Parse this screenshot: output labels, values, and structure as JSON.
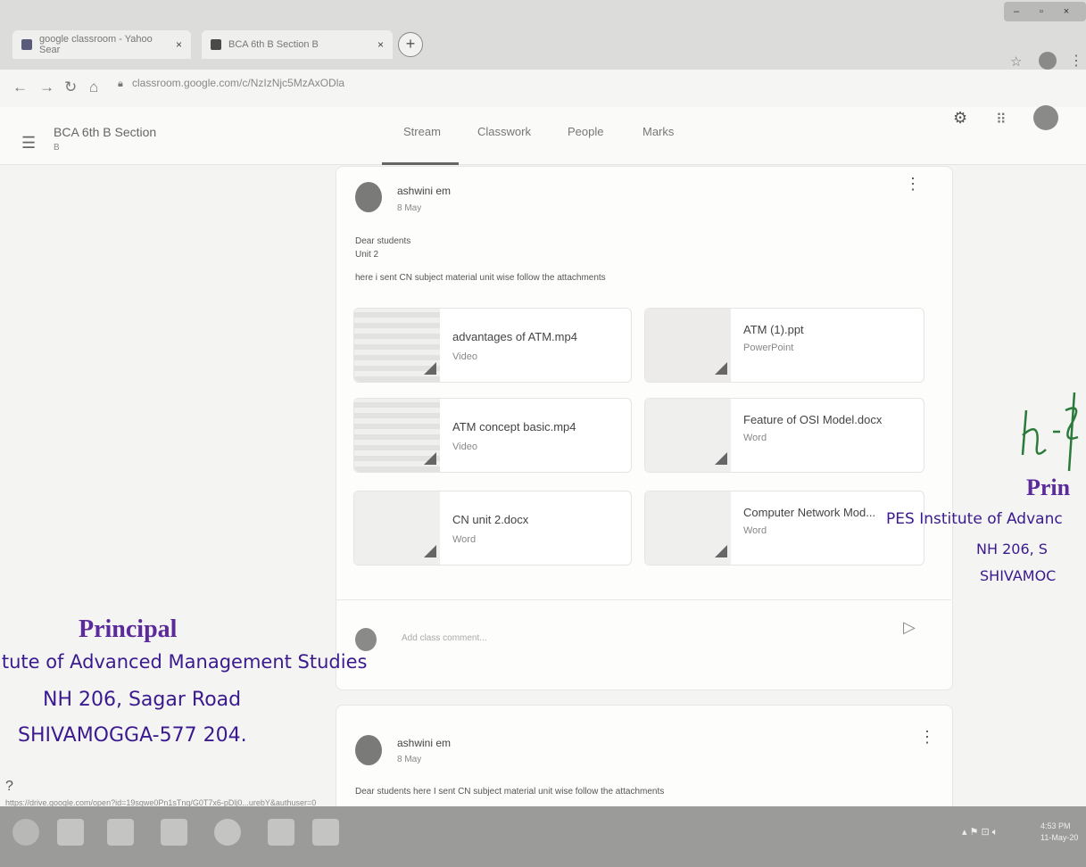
{
  "browser": {
    "tabs": [
      {
        "label": "google classroom - Yahoo Sear",
        "close": "×"
      },
      {
        "label": "BCA 6th B Section B",
        "close": "×"
      }
    ],
    "new_tab": "+",
    "url": "classroom.google.com/c/NzIzNjc5MzAxODla",
    "window_controls": [
      "–",
      "▫",
      "×"
    ],
    "star": "☆"
  },
  "classroom": {
    "class_title": "BCA 6th B Section",
    "class_sub": "B",
    "tabs": [
      "Stream",
      "Classwork",
      "People",
      "Marks"
    ]
  },
  "post1": {
    "author": "ashwini em",
    "date": "8 May",
    "lines": [
      "Dear students",
      "Unit 2",
      "here i sent CN subject material unit wise follow the attachments"
    ],
    "attachments": [
      {
        "title": "advantages of ATM.mp4",
        "type": "Video"
      },
      {
        "title": "ATM (1).ppt",
        "type": "PowerPoint"
      },
      {
        "title": "ATM concept basic.mp4",
        "type": "Video"
      },
      {
        "title": "Feature of OSI Model.docx",
        "type": "Word"
      },
      {
        "title": "CN unit 2.docx",
        "type": "Word"
      },
      {
        "title": "Computer Network Mod...",
        "type": "Word"
      }
    ],
    "comment_placeholder": "Add class comment..."
  },
  "post2": {
    "author": "ashwini em",
    "date": "8 May",
    "text": "Dear students here I sent CN subject material unit wise follow the attachments"
  },
  "status_url": "https://drive.google.com/open?id=19sqwe0Pn1sTnq/G0T7x6-pDlj0...urebY&authuser=0",
  "help_icon": "?",
  "taskbar": {
    "time": "4:53 PM",
    "date": "11-May-20"
  },
  "stamps": {
    "left": {
      "title": "Principal",
      "line1": "itute of Advanced Management Studies",
      "line2": "NH 206, Sagar Road",
      "line3": "SHIVAMOGGA-577 204."
    },
    "right": {
      "title": "Prin",
      "line1": "PES Institute of Advanc",
      "line2": "NH 206, S",
      "line3": "SHIVAMOC"
    }
  }
}
